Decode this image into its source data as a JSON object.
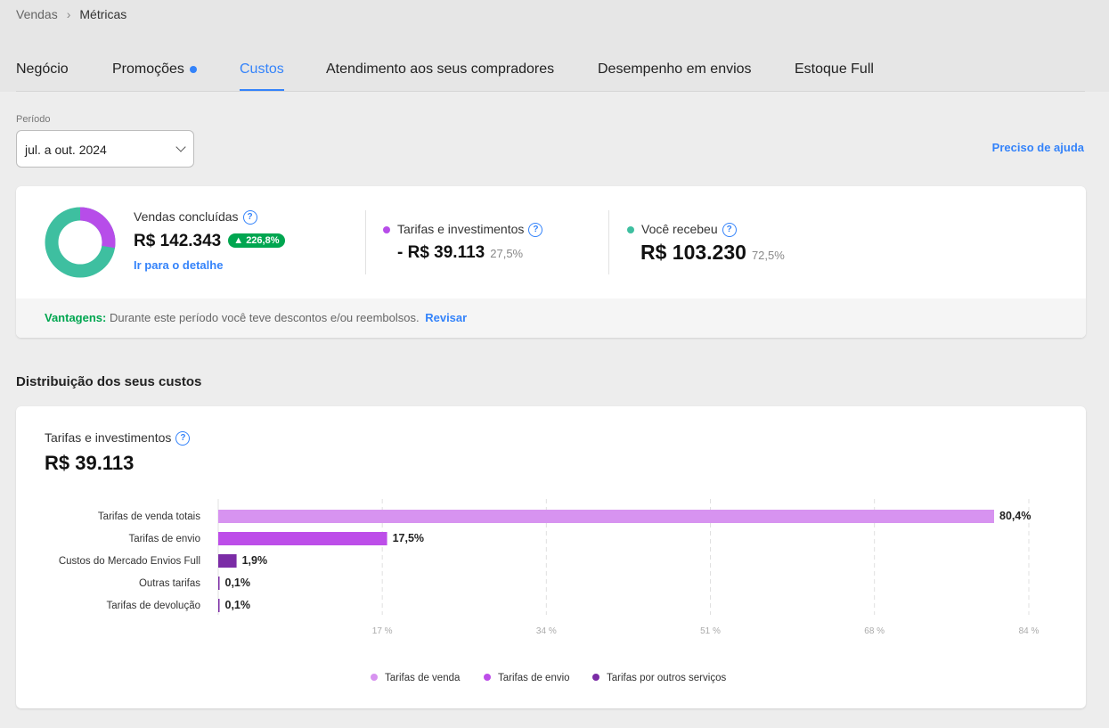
{
  "breadcrumb": [
    "Vendas",
    "Métricas"
  ],
  "tabs": [
    {
      "label": "Negócio"
    },
    {
      "label": "Promoções"
    },
    {
      "label": "Custos"
    },
    {
      "label": "Atendimento aos seus compradores"
    },
    {
      "label": "Desempenho em envios"
    },
    {
      "label": "Estoque Full"
    }
  ],
  "period": {
    "label": "Período",
    "value": "jul. a out. 2024"
  },
  "help_link": "Preciso de ajuda",
  "summary": {
    "sales_label": "Vendas concluídas",
    "sales_value": "R$ 142.343",
    "sales_badge": "▲ 226,8%",
    "detail_link": "Ir para o detalhe",
    "fees_label": "Tarifas e investimentos",
    "fees_value": "- R$ 39.113",
    "fees_pct": "27,5%",
    "received_label": "Você recebeu",
    "received_value": "R$ 103.230",
    "received_pct": "72,5%",
    "donut": {
      "fees_fraction": 0.275,
      "fees_color": "#b74de9",
      "received_color": "#3ebfa0"
    }
  },
  "advantages": {
    "title": "Vantagens:",
    "text": "Durante este período você teve descontos e/ou reembolsos.",
    "link": "Revisar"
  },
  "section_title": "Distribuição dos seus custos",
  "costs": {
    "label": "Tarifas e investimentos",
    "value": "R$ 39.113"
  },
  "colors": {
    "accent": "#3483fa",
    "positive": "#00a650"
  },
  "chart_data": {
    "type": "bar",
    "orientation": "horizontal",
    "categories": [
      "Tarifas de venda totais",
      "Tarifas de envio",
      "Custos do Mercado Envios Full",
      "Outras tarifas",
      "Tarifas de devolução"
    ],
    "values": [
      80.4,
      17.5,
      1.9,
      0.1,
      0.1
    ],
    "value_labels": [
      "80,4%",
      "17,5%",
      "1,9%",
      "0,1%",
      "0,1%"
    ],
    "bar_colors": [
      "#d793f0",
      "#bd4ee9",
      "#7b2ca6",
      "#7b2ca6",
      "#7b2ca6"
    ],
    "xticks": [
      17,
      34,
      51,
      68,
      84
    ],
    "xtick_labels": [
      "17 %",
      "34 %",
      "51 %",
      "68 %",
      "84 %"
    ],
    "xlim": [
      0,
      84
    ],
    "grid": true,
    "legend_position": "bottom",
    "legend": [
      {
        "label": "Tarifas de venda",
        "color": "#d793f0"
      },
      {
        "label": "Tarifas de envio",
        "color": "#bd4ee9"
      },
      {
        "label": "Tarifas por outros serviços",
        "color": "#7b2ca6"
      }
    ]
  }
}
